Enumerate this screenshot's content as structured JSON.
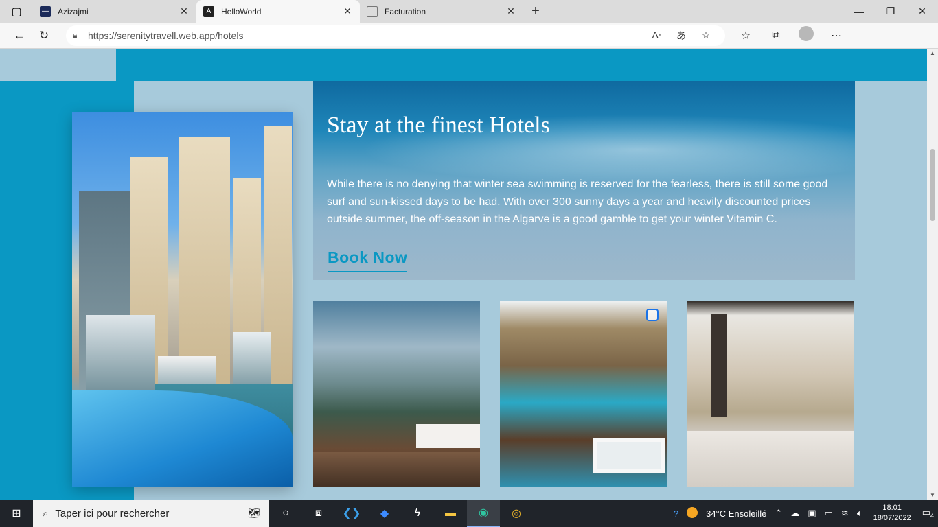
{
  "browser": {
    "tabs": [
      {
        "title": "Azizajmi",
        "favicon": "app-icon"
      },
      {
        "title": "HelloWorld",
        "favicon": "angular-icon",
        "active": true
      },
      {
        "title": "Facturation",
        "favicon": "page-icon"
      }
    ],
    "url": "https://serenitytravell.web.app/hotels"
  },
  "page": {
    "banner": {
      "title": "Stay at the finest Hotels",
      "text": "While there is no denying that winter sea swimming is reserved for the fearless, there is still some good surf and sun-kissed days to be had. With over 300 sunny days a year and heavily discounted prices outside summer, the off-season in the Algarve is a good gamble to get your winter Vitamin C.",
      "cta": "Book Now"
    },
    "colors": {
      "accent": "#0a98c3",
      "panel": "#a7cadb"
    }
  },
  "taskbar": {
    "search_placeholder": "Taper ici pour rechercher",
    "weather": "34°C  Ensoleillé",
    "time": "18:01",
    "date": "18/07/2022",
    "notifications": "4"
  }
}
